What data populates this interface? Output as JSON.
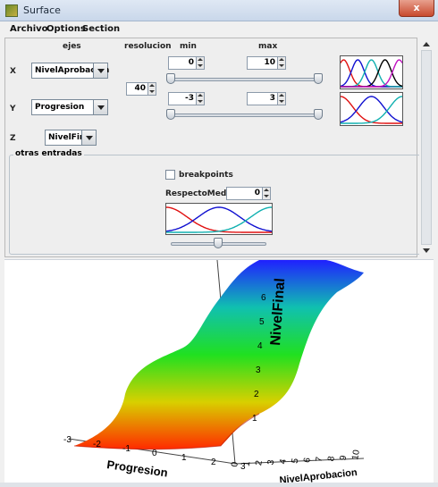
{
  "window": {
    "title": "Surface",
    "close_label": "x"
  },
  "menu": {
    "items": [
      "Archivo",
      "Options",
      "Section"
    ]
  },
  "headers": {
    "ejes": "ejes",
    "resolucion": "resolucion",
    "min": "min",
    "max": "max"
  },
  "axes": {
    "x": {
      "label": "X",
      "variable": "NivelAprobacion",
      "min": "0",
      "max": "10",
      "slider_min_fraction": 0.0,
      "slider_max_fraction": 1.0
    },
    "y": {
      "label": "Y",
      "variable": "Progresion",
      "min": "-3",
      "max": "3",
      "slider_min_fraction": 0.0,
      "slider_max_fraction": 1.0
    },
    "z": {
      "label": "Z",
      "variable": "NivelFinal"
    }
  },
  "resolucion_value": "40",
  "otras": {
    "title": "otras entradas",
    "breakpoints_label": "breakpoints",
    "breakpoints_checked": false,
    "respecto_label": "RespectoMedia",
    "respecto_value": "0",
    "slider_fraction": 0.5
  },
  "mf_colors": [
    "#e01010",
    "#1010d0",
    "#10b0b0",
    "#000000",
    "#c010c0"
  ],
  "surface_plot": {
    "z_label": "NivelFinal",
    "y_label": "Progresion",
    "x_label": "NivelAprobacion",
    "z_ticks": [
      "1",
      "2",
      "3",
      "4",
      "5",
      "6"
    ],
    "y_ticks": [
      "-3",
      "-2",
      "-1",
      "0",
      "1",
      "2",
      "3"
    ],
    "x_ticks": [
      "0",
      "1",
      "2",
      "3",
      "4",
      "5",
      "6",
      "7",
      "8",
      "9",
      "10"
    ]
  }
}
